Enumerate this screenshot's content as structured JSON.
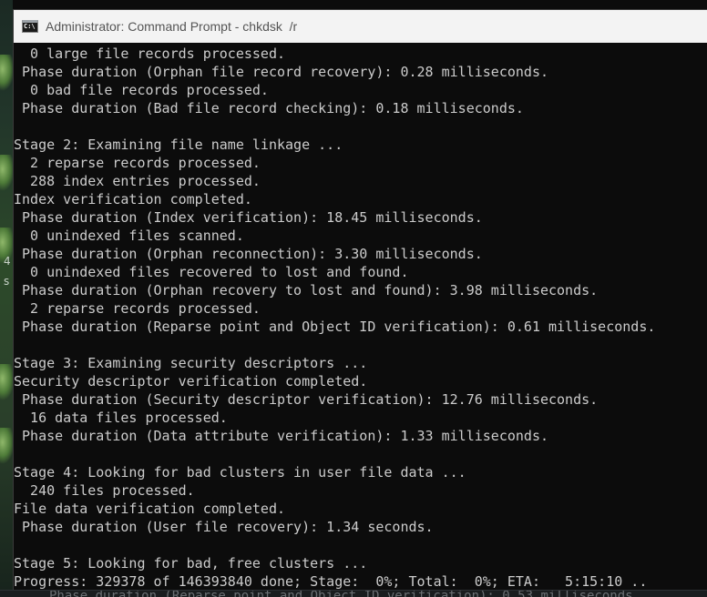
{
  "window": {
    "title": "Administrator: Command Prompt - chkdsk  /r",
    "icon": "cmd-icon",
    "icon_glyph": "C:\\"
  },
  "console": {
    "lines": [
      "  0 large file records processed.",
      " Phase duration (Orphan file record recovery): 0.28 milliseconds.",
      "  0 bad file records processed.",
      " Phase duration (Bad file record checking): 0.18 milliseconds.",
      "",
      "Stage 2: Examining file name linkage ...",
      "  2 reparse records processed.",
      "  288 index entries processed.",
      "Index verification completed.",
      " Phase duration (Index verification): 18.45 milliseconds.",
      "  0 unindexed files scanned.",
      " Phase duration (Orphan reconnection): 3.30 milliseconds.",
      "  0 unindexed files recovered to lost and found.",
      " Phase duration (Orphan recovery to lost and found): 3.98 milliseconds.",
      "  2 reparse records processed.",
      " Phase duration (Reparse point and Object ID verification): 0.61 milliseconds.",
      "",
      "Stage 3: Examining security descriptors ...",
      "Security descriptor verification completed.",
      " Phase duration (Security descriptor verification): 12.76 milliseconds.",
      "  16 data files processed.",
      " Phase duration (Data attribute verification): 1.33 milliseconds.",
      "",
      "Stage 4: Looking for bad clusters in user file data ...",
      "  240 files processed.",
      "File data verification completed.",
      " Phase duration (User file recovery): 1.34 seconds.",
      "",
      "Stage 5: Looking for bad, free clusters ...",
      "Progress: 329378 of 146393840 done; Stage:  0%; Total:  0%; ETA:   5:15:10 .."
    ]
  },
  "background": {
    "side_text_1": "4",
    "side_text_2": "s",
    "behind_window_text": "Phase duration (Reparse point and Object ID verification): 0.53 milliseconds."
  }
}
